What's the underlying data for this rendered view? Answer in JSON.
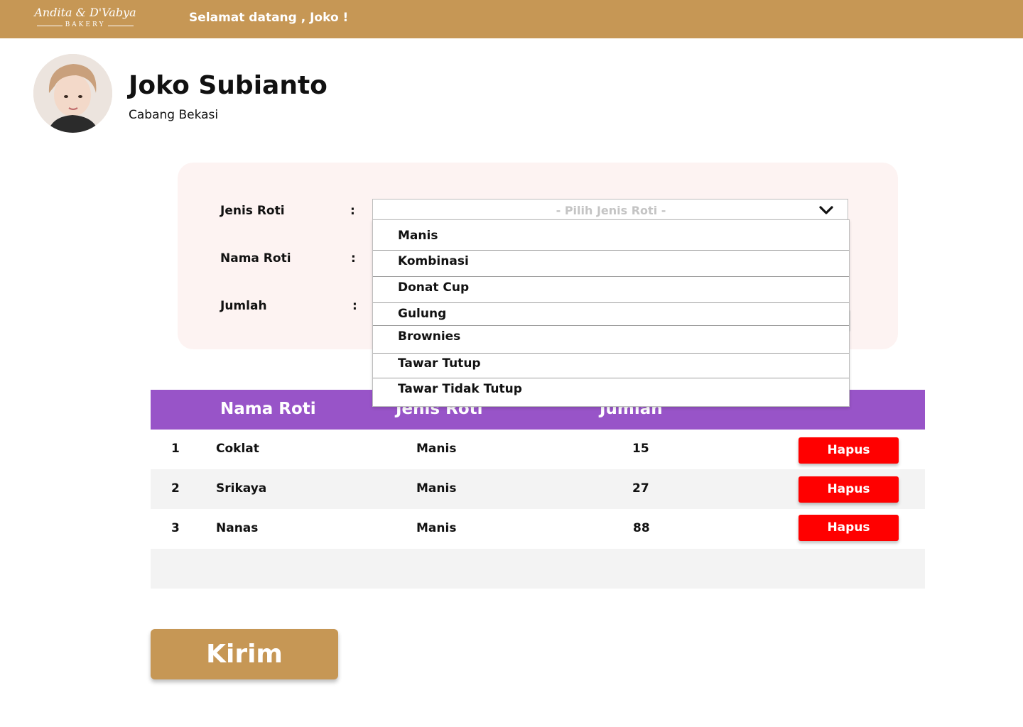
{
  "header": {
    "logo_main": "Andita & D'Vabya",
    "logo_sub": "BAKERY",
    "welcome": "Selamat datang , Joko !"
  },
  "profile": {
    "name": "Joko Subianto",
    "branch": "Cabang Bekasi"
  },
  "form": {
    "fields": [
      {
        "label": "Jenis Roti",
        "colon": ":"
      },
      {
        "label": "Nama Roti",
        "colon": ":"
      },
      {
        "label": "Jumlah",
        "colon": ":"
      }
    ],
    "jenis_select": {
      "placeholder": "- Pilih Jenis Roti -",
      "options": [
        "Manis",
        "Kombinasi",
        "Donat Cup",
        "Gulung",
        "Brownies",
        "Tawar Tutup",
        "Tawar Tidak Tutup"
      ]
    }
  },
  "table": {
    "headers": [
      "Nama Roti",
      "Jenis Roti",
      "Jumlah"
    ],
    "rows": [
      {
        "no": "1",
        "nama": "Coklat",
        "jenis": "Manis",
        "jumlah": "15",
        "action": "Hapus"
      },
      {
        "no": "2",
        "nama": "Srikaya",
        "jenis": "Manis",
        "jumlah": "27",
        "action": "Hapus"
      },
      {
        "no": "3",
        "nama": "Nanas",
        "jenis": "Manis",
        "jumlah": "88",
        "action": "Hapus"
      }
    ]
  },
  "submit_label": "Kirim",
  "colors": {
    "brand": "#C69755",
    "table_header": "#9854C8",
    "delete_button": "#FF0000",
    "form_bg": "#FDF3F2"
  },
  "icons": {
    "select": "chevron-down-icon",
    "avatar": "user-avatar"
  }
}
